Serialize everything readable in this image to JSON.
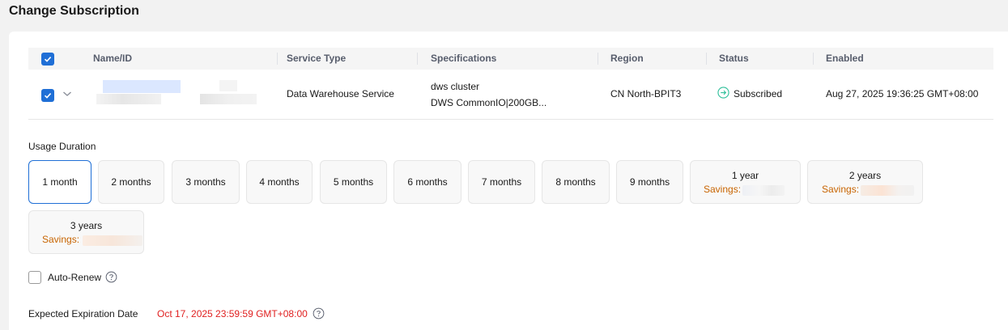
{
  "page": {
    "title": "Change Subscription"
  },
  "table": {
    "headers": {
      "name": "Name/ID",
      "service_type": "Service Type",
      "specifications": "Specifications",
      "region": "Region",
      "status": "Status",
      "enabled": "Enabled"
    },
    "row": {
      "service_type": "Data Warehouse Service",
      "spec_line1": "dws cluster",
      "spec_line2": "DWS CommonIO|200GB...",
      "region": "CN North-BPIT3",
      "status": "Subscribed",
      "enabled": "Aug 27, 2025 19:36:25 GMT+08:00"
    }
  },
  "duration": {
    "label": "Usage Duration",
    "selected": "1 month",
    "options": [
      {
        "label": "1 month"
      },
      {
        "label": "2 months"
      },
      {
        "label": "3 months"
      },
      {
        "label": "4 months"
      },
      {
        "label": "5 months"
      },
      {
        "label": "6 months"
      },
      {
        "label": "7 months"
      },
      {
        "label": "8 months"
      },
      {
        "label": "9 months"
      },
      {
        "label": "1 year",
        "savings_label": "Savings:"
      },
      {
        "label": "2 years",
        "savings_label": "Savings:"
      },
      {
        "label": "3 years",
        "savings_label": "Savings:"
      }
    ]
  },
  "auto_renew": {
    "label": "Auto-Renew",
    "checked": false
  },
  "expiration": {
    "label": "Expected Expiration Date",
    "value": "Oct 17, 2025 23:59:59 GMT+08:00"
  },
  "colors": {
    "accent": "#1f6fd6",
    "savings": "#c86400",
    "expiration": "#e02020",
    "status_ok": "#2fbf9a"
  },
  "icons": {
    "header_checkbox": "checkbox-checked-icon",
    "row_checkbox": "checkbox-checked-icon",
    "expand": "chevron-down-icon",
    "status": "arrow-circle-right-icon",
    "help": "question-circle-icon"
  }
}
